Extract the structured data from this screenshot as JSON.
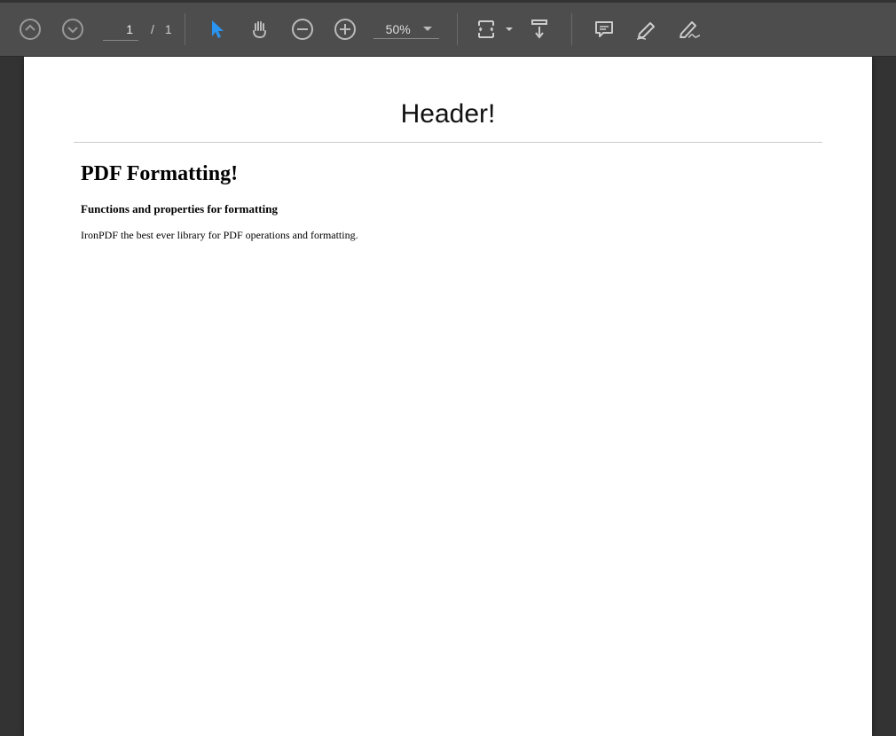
{
  "toolbar": {
    "page_current": "1",
    "page_separator": "/",
    "page_total": "1",
    "zoom_value": "50%"
  },
  "document": {
    "header": "Header!",
    "title": "PDF Formatting!",
    "subtitle": "Functions and properties for formatting",
    "body": "IronPDF the best ever library for PDF operations and formatting."
  }
}
